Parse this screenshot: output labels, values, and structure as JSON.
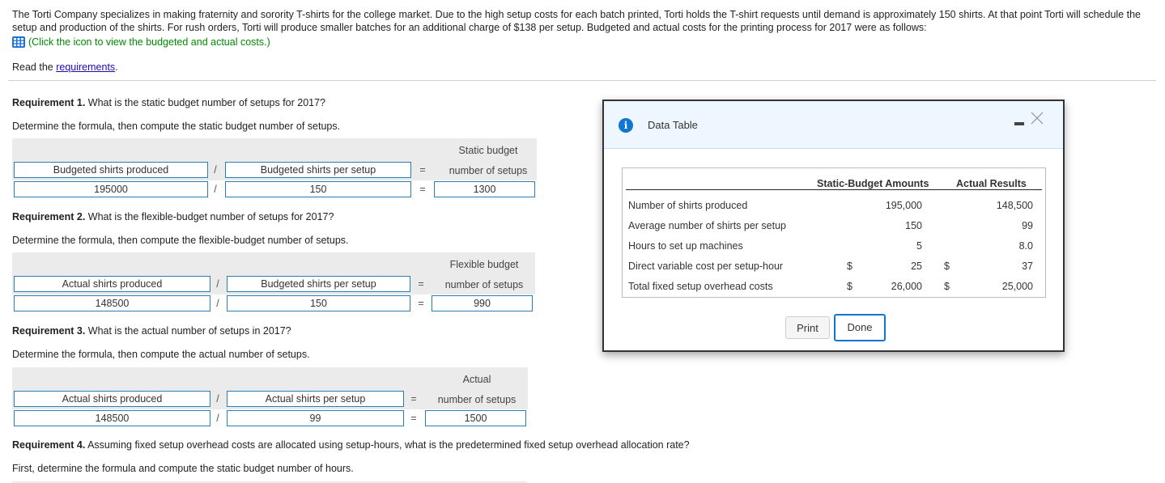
{
  "intro": {
    "paragraph": "The Torti Company specializes in making fraternity and sorority T-shirts for the college market. Due to the high setup costs for each batch printed, Torti holds the T-shirt requests until demand is approximately 150 shirts. At that point Torti will schedule the setup and production of the shirts. For rush orders, Torti will produce smaller batches for an additional charge of $138 per setup. Budgeted and actual costs for the printing process for 2017 were as follows:",
    "icon_link": "(Click the icon to view the budgeted and actual costs.)",
    "icon": "table-grid-icon",
    "read_prefix": "Read the ",
    "read_link": "requirements",
    "read_suffix": "."
  },
  "requirements": [
    {
      "title": "Requirement 1.",
      "question": " What is the static budget number of setups for 2017?",
      "instruction": "Determine the formula, then compute the static budget number of setups.",
      "result_label_1": "Static budget",
      "result_label_2": "number of setups",
      "formula": [
        "Budgeted shirts produced",
        "Budgeted shirts per setup"
      ],
      "values": [
        "195000",
        "150",
        "1300"
      ],
      "ops": [
        "/",
        "="
      ]
    },
    {
      "title": "Requirement 2.",
      "question": " What is the flexible-budget number of setups for 2017?",
      "instruction": "Determine the formula, then compute the flexible-budget number of setups.",
      "result_label_1": "Flexible budget",
      "result_label_2": "number of setups",
      "formula": [
        "Actual shirts produced",
        "Budgeted shirts per setup"
      ],
      "values": [
        "148500",
        "150",
        "990"
      ],
      "ops": [
        "/",
        "="
      ]
    },
    {
      "title": "Requirement 3.",
      "question": " What is the actual number of setups in 2017?",
      "instruction": "Determine the formula, then compute the actual number of setups.",
      "result_label_1": "Actual",
      "result_label_2": "number of setups",
      "formula": [
        "Actual shirts produced",
        "Actual shirts per setup"
      ],
      "values": [
        "148500",
        "99",
        "1500"
      ],
      "ops": [
        "/",
        "="
      ]
    },
    {
      "title": "Requirement 4.",
      "question": " Assuming fixed setup overhead costs are allocated using setup-hours, what is the predetermined fixed setup overhead allocation rate?",
      "instruction": "First, determine the formula and compute the static budget number of hours."
    }
  ],
  "dialog": {
    "title": "Data Table",
    "icon": "info-icon",
    "headers": [
      "Static-Budget Amounts",
      "Actual Results"
    ],
    "rows": [
      {
        "label": "Number of shirts produced",
        "static_sym": "",
        "static": "195,000",
        "actual_sym": "",
        "actual": "148,500"
      },
      {
        "label": "Average number of shirts per setup",
        "static_sym": "",
        "static": "150",
        "actual_sym": "",
        "actual": "99"
      },
      {
        "label": "Hours to set up machines",
        "static_sym": "",
        "static": "5",
        "actual_sym": "",
        "actual": "8.0"
      },
      {
        "label": "Direct variable cost per setup-hour",
        "static_sym": "$",
        "static": "25",
        "actual_sym": "$",
        "actual": "37"
      },
      {
        "label": "Total fixed setup overhead costs",
        "static_sym": "$",
        "static": "26,000",
        "actual_sym": "$",
        "actual": "25,000"
      }
    ],
    "print_label": "Print",
    "done_label": "Done"
  }
}
